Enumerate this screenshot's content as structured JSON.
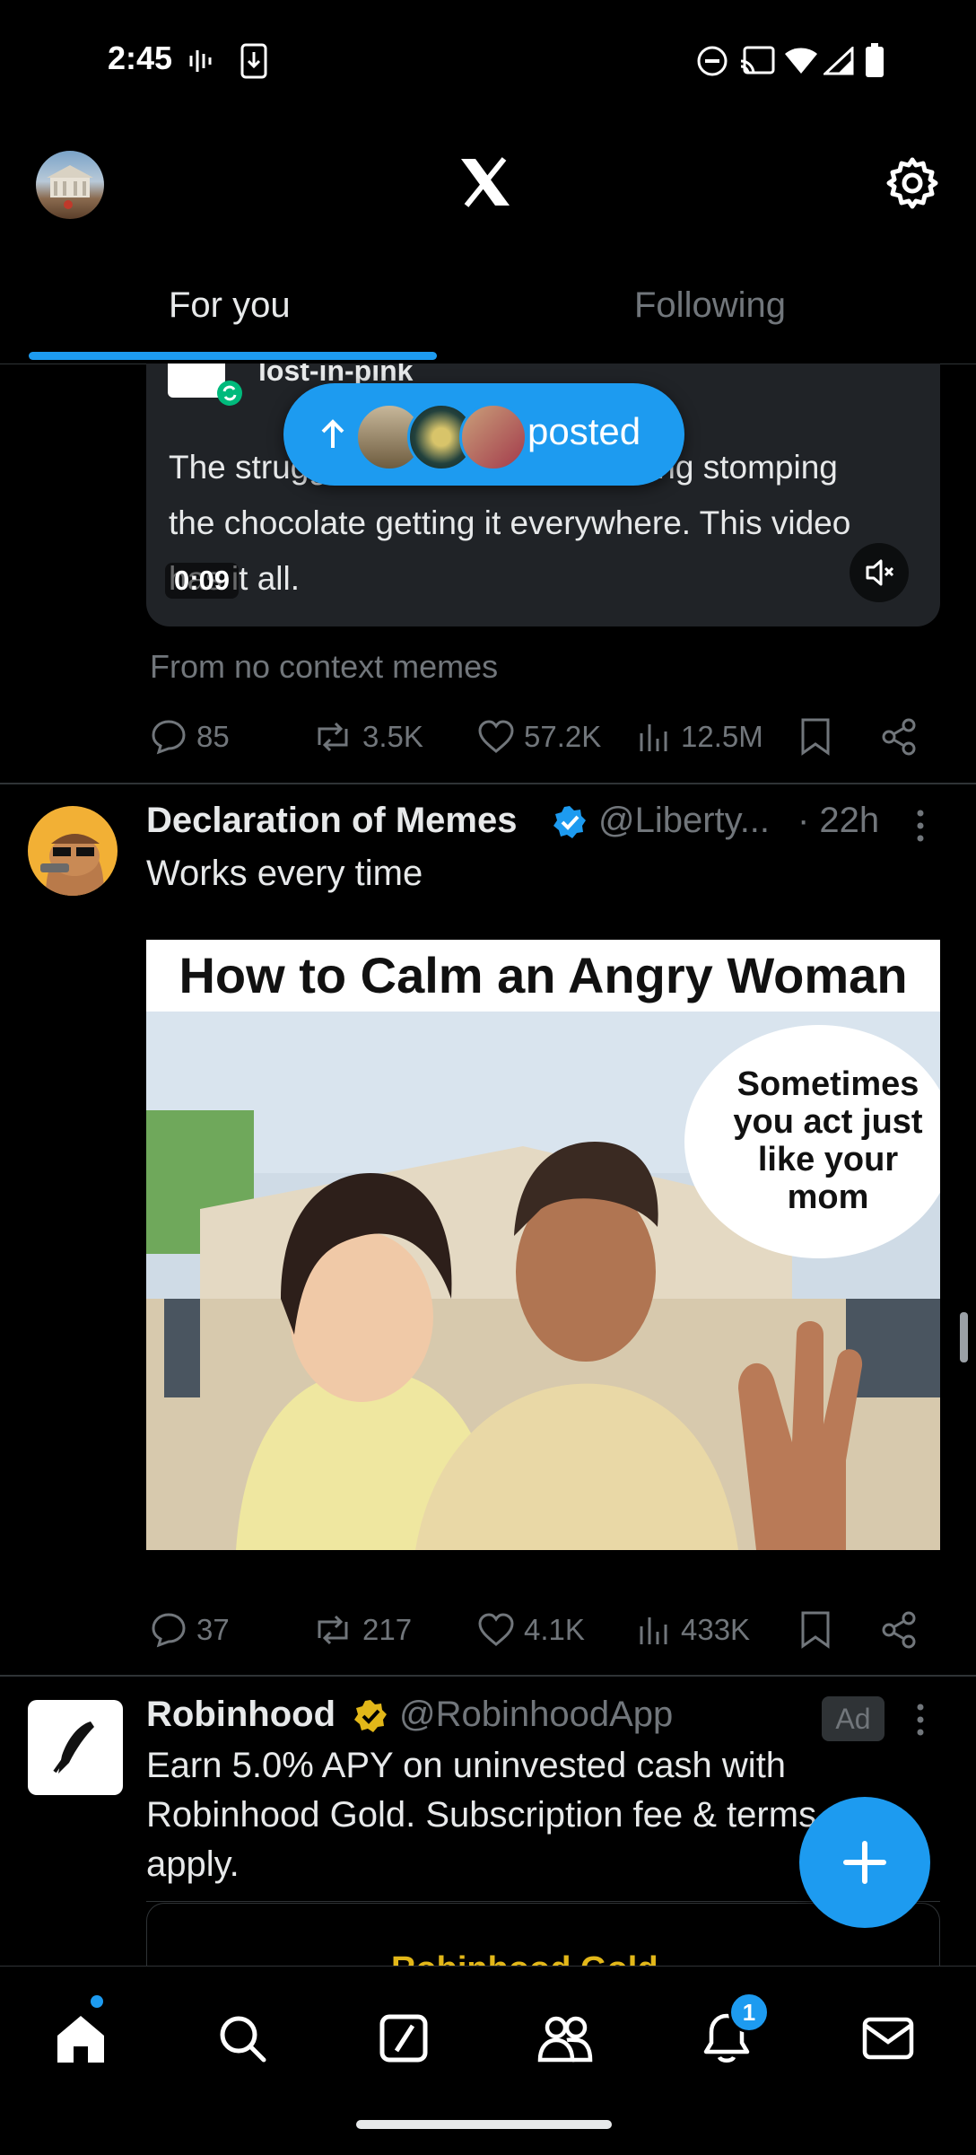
{
  "status_bar": {
    "time": "2:45"
  },
  "tabs": [
    {
      "label": "For you"
    },
    {
      "label": "Following"
    }
  ],
  "prev_tweet": {
    "card_user": "lost-in-pink",
    "overlay_text": "The struggle is real. The cat fucking stomping the chocolate getting it everywhere. This video has it all.",
    "video_duration": "0:09",
    "posted_pill_label": "posted",
    "context": "From no context memes",
    "replies": "85",
    "reposts": "3.5K",
    "likes": "57.2K",
    "views": "12.5M"
  },
  "tweet": {
    "name": "Declaration of Memes",
    "handle": "@Liberty...",
    "time": "· 22h",
    "text": "Works every time",
    "image": {
      "title": "How to Calm an Angry Woman",
      "speech": "Sometimes you act just like your mom"
    },
    "replies": "37",
    "reposts": "217",
    "likes": "4.1K",
    "views": "433K"
  },
  "ad_tweet": {
    "name": "Robinhood",
    "handle": "@RobinhoodApp",
    "badge": "Ad",
    "text": "Earn 5.0% APY on uninvested cash with Robinhood Gold. Subscription fee & terms apply.",
    "card_peek": "Robinhood Gold"
  },
  "notifications_count": "1",
  "colors": {
    "accent": "#1d9bf0",
    "verified_blue": "#1d9bf0",
    "verified_gold": "#e2b719",
    "bg": "#000000"
  }
}
